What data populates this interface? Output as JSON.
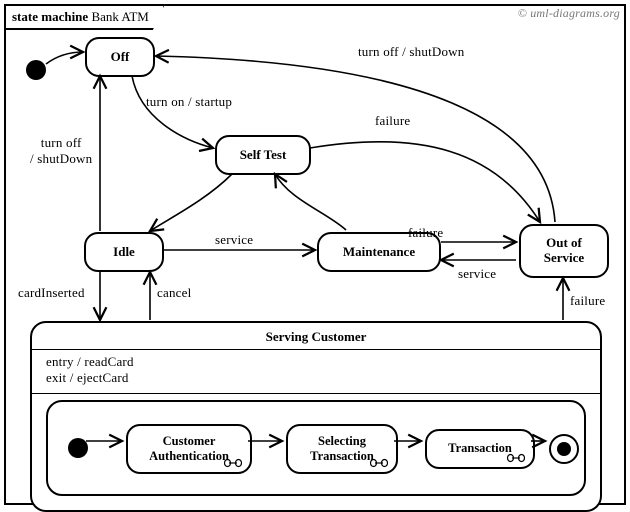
{
  "attribution": "© uml-diagrams.org",
  "frame": {
    "keyword": "state machine",
    "name": "Bank ATM"
  },
  "states": {
    "off": "Off",
    "self_test": "Self Test",
    "idle": "Idle",
    "maintenance": "Maintenance",
    "out_of_service_l1": "Out of",
    "out_of_service_l2": "Service",
    "serving_customer": "Serving Customer",
    "entry": "entry / readCard",
    "exit": "exit / ejectCard",
    "customer_auth_l1": "Customer",
    "customer_auth_l2": "Authentication",
    "selecting_l1": "Selecting",
    "selecting_l2": "Transaction",
    "transaction": "Transaction"
  },
  "transitions": {
    "turn_on": "turn on / startup",
    "turn_off_shutdown": "turn off / shutDown",
    "turn_off_l1": "turn off",
    "turn_off_l2": "/ shutDown",
    "failure": "failure",
    "service": "service",
    "card_inserted": "cardInserted",
    "cancel": "cancel"
  }
}
